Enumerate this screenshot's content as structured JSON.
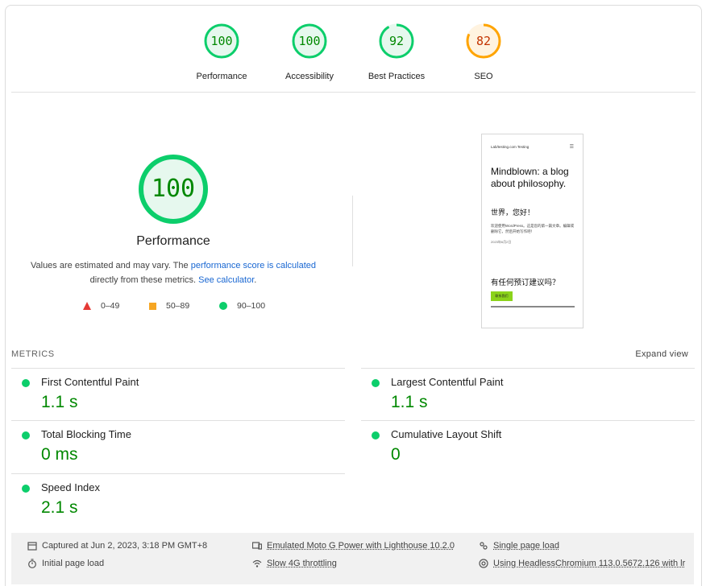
{
  "gauges": [
    {
      "label": "Performance",
      "score": "100",
      "value": 100,
      "color": "#0cce6b",
      "text_color": "#008800"
    },
    {
      "label": "Accessibility",
      "score": "100",
      "value": 100,
      "color": "#0cce6b",
      "text_color": "#008800"
    },
    {
      "label": "Best Practices",
      "score": "92",
      "value": 92,
      "color": "#0cce6b",
      "text_color": "#008800"
    },
    {
      "label": "SEO",
      "score": "82",
      "value": 82,
      "color": "#ffa400",
      "text_color": "#c33300"
    }
  ],
  "main": {
    "score": "100",
    "value": 100,
    "title": "Performance",
    "desc_prefix": "Values are estimated and may vary. The ",
    "desc_link": "performance score is calculated",
    "desc_mid": " directly from these metrics. ",
    "desc_link2": "See calculator",
    "desc_suffix": "."
  },
  "legend": [
    {
      "range": "0–49",
      "icon": "triangle-icon"
    },
    {
      "range": "50–89",
      "icon": "square-icon"
    },
    {
      "range": "90–100",
      "icon": "circle-icon"
    }
  ],
  "thumbnail": {
    "site": "Lab/testing.com Testing",
    "menu": "☰",
    "heading": "Mindblown: a blog about philosophy.",
    "post_title": "世界，您好！",
    "post_text": "欢迎使用WordPress。这是您的第一篇文章。编辑或删除它，然后开始写作吧！",
    "date": "2023年6月2日",
    "cta_heading": "有任何预订建议吗？",
    "cta_button": "联系我们"
  },
  "metrics": {
    "heading": "METRICS",
    "expand": "Expand view",
    "items": [
      {
        "name": "First Contentful Paint",
        "value": "1.1 s"
      },
      {
        "name": "Largest Contentful Paint",
        "value": "1.1 s"
      },
      {
        "name": "Total Blocking Time",
        "value": "0 ms"
      },
      {
        "name": "Cumulative Layout Shift",
        "value": "0"
      },
      {
        "name": "Speed Index",
        "value": "2.1 s"
      }
    ]
  },
  "footer": {
    "captured": "Captured at Jun 2, 2023, 3:18 PM GMT+8",
    "device": "Emulated Moto G Power with Lighthouse 10.2.0",
    "load": "Single page load",
    "initial": "Initial page load",
    "throttle": "Slow 4G throttling",
    "browser": "Using HeadlessChromium 113.0.5672.126 with lr"
  }
}
